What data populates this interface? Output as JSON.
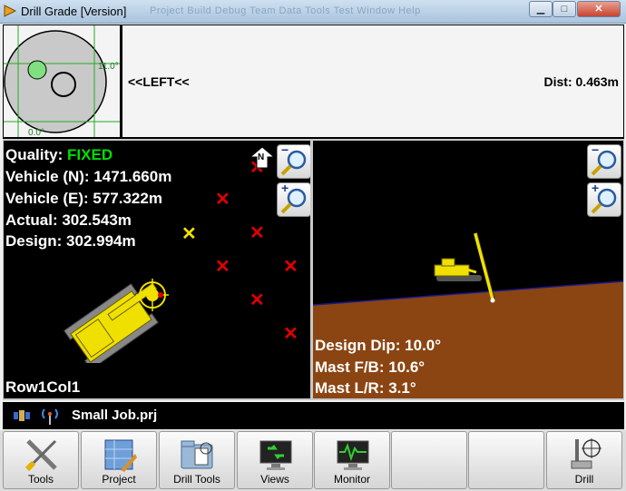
{
  "window": {
    "title": "Drill Grade [Version]",
    "faded_menu": "Project   Build   Debug   Team   Data   Tools   Test   Window   Help",
    "minimize": "▁",
    "maximize": "□",
    "close": "✕"
  },
  "scope": {
    "label_right": "11.0°",
    "label_bottom": "0.0°"
  },
  "guidance": {
    "direction": "<<LEFT<<",
    "dist_label": "Dist:",
    "dist_value": "0.463m"
  },
  "plan": {
    "quality_label": "Quality:",
    "quality_value": "FIXED",
    "vehicle_n": "Vehicle (N): 1471.660m",
    "vehicle_e": "Vehicle (E): 577.322m",
    "actual": "Actual: 302.543m",
    "design": "Design: 302.994m",
    "north": "N",
    "row_label": "Row1Col1",
    "zoom_out": "−",
    "zoom_in": "+"
  },
  "profile": {
    "design_dip": "Design Dip: 10.0°",
    "mast_fb": "Mast F/B: 10.6°",
    "mast_lr": "Mast L/R: 3.1°",
    "zoom_out": "−",
    "zoom_in": "+"
  },
  "status": {
    "job": "Small Job.prj"
  },
  "toolbar": {
    "tools": "Tools",
    "project": "Project",
    "drill_tools": "Drill Tools",
    "views": "Views",
    "monitor": "Monitor",
    "drill": "Drill"
  },
  "colors": {
    "quality_fixed": "#00e000",
    "hole_marker": "#e00000",
    "active_hole": "#f0e000",
    "machine": "#f0e000",
    "ground": "#8b4513"
  }
}
